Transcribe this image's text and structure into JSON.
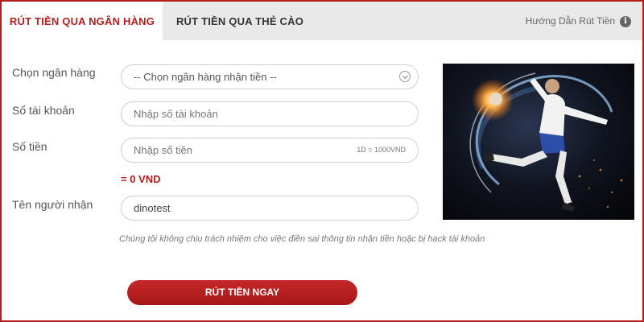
{
  "tabs": [
    {
      "label": "RÚT TIỀN QUA NGÂN HÀNG",
      "active": true
    },
    {
      "label": "RÚT TIỀN QUA THẺ CÀO",
      "active": false
    }
  ],
  "guide": {
    "label": "Hướng Dẫn Rút Tiền",
    "icon": "info-icon",
    "icon_glyph": "i"
  },
  "form": {
    "bank": {
      "label": "Chọn ngân hàng",
      "selected": "-- Chọn ngân hàng nhận tiền --",
      "icon": "chevron-down-icon"
    },
    "account": {
      "label": "Số tài khoản",
      "placeholder": "Nhập số tài khoản"
    },
    "amount": {
      "label": "Số tiền",
      "placeholder": "Nhập số tiền",
      "rate": "1D = 1000VND"
    },
    "converted": "= 0 VND",
    "recipient": {
      "label": "Tên người nhận",
      "value": "dinotest"
    }
  },
  "disclaimer": "Chúng tôi không chịu trách nhiệm cho việc điền sai thông tin nhận tiền hoặc bị hack tài khoản",
  "submit_label": "RÚT TIỀN NGAY",
  "colors": {
    "accent": "#b71c1c",
    "tabbar": "#e9e9e9"
  }
}
